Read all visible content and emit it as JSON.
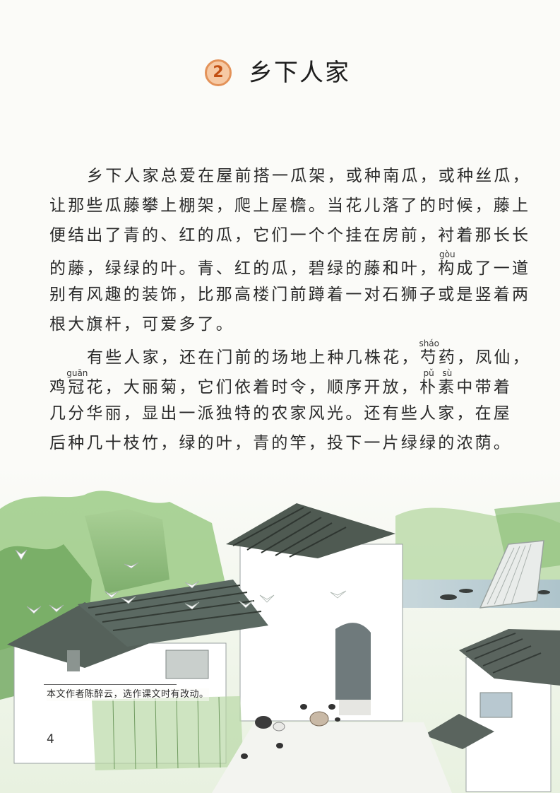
{
  "lesson": {
    "number": "2",
    "title": "乡下人家"
  },
  "paragraphs": [
    {
      "lines": [
        [
          {
            "t": "乡下人家总爱在屋前搭一瓜架，或种南瓜，或种丝瓜，"
          }
        ],
        [
          {
            "t": "让那些瓜藤攀上棚架，爬上屋檐。当花儿落了的时候，藤上"
          }
        ],
        [
          {
            "t": "便结出了青的、红的瓜，它们一个个挂在房前，衬着那长长"
          }
        ],
        [
          {
            "t": "的藤，绿绿的叶。青、红的瓜，碧绿的藤和叶，"
          },
          {
            "t": "构",
            "py": "gòu"
          },
          {
            "t": "成了一道"
          }
        ],
        [
          {
            "t": "别有风趣的装饰，比那高楼门前蹲着一对石狮子或是竖着两"
          }
        ],
        [
          {
            "t": "根大旗杆，可爱多了。"
          }
        ]
      ]
    },
    {
      "lines": [
        [
          {
            "t": "有些人家，还在门前的场地上种几株花，"
          },
          {
            "t": "芍",
            "py": "sháo"
          },
          {
            "t": "药，凤仙，"
          }
        ],
        [
          {
            "t": "鸡"
          },
          {
            "t": "冠",
            "py": "guān"
          },
          {
            "t": "花，大丽菊，它们依着时令，顺序开放，"
          },
          {
            "t": "朴",
            "py": "pǔ"
          },
          {
            "t": "素",
            "py": "sù"
          },
          {
            "t": "中带着"
          }
        ],
        [
          {
            "t": "几分华丽，显出一派独特的农家风光。还有些人家，在屋"
          }
        ],
        [
          {
            "t": "后种几十枝竹，绿的叶，青的竿，投下一片绿绿的浓荫。"
          }
        ]
      ]
    }
  ],
  "footnote": "本文作者陈醉云，选作课文时有改动。",
  "page_number": "4",
  "colors": {
    "badge_fill": "#f6c9a4",
    "badge_border": "#e39259",
    "badge_text": "#c24f12",
    "roof": "#4f5a52",
    "foliage": "#8bbf7a",
    "wall": "#ffffff"
  }
}
